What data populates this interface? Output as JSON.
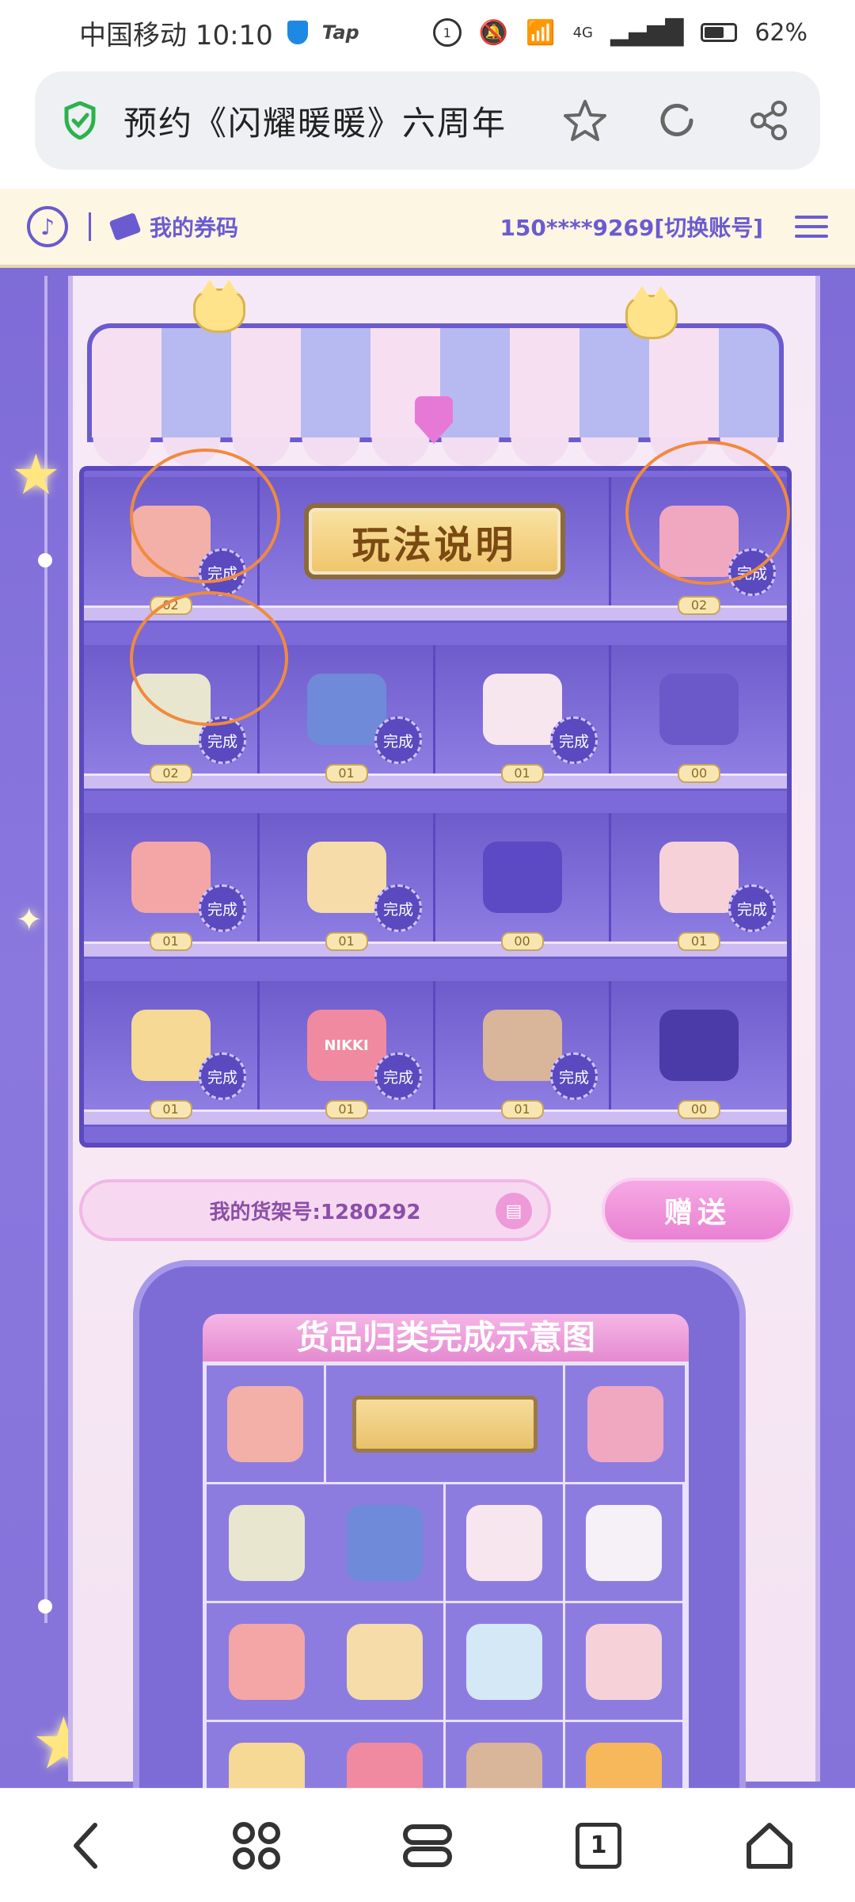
{
  "status_bar": {
    "carrier_time": "中国移动 10:10",
    "tap_label": "Tap",
    "network": "4G",
    "battery": "62%"
  },
  "browser": {
    "title": "预约《闪耀暖暖》六周年",
    "icons": [
      "shield-check-icon",
      "star-icon",
      "refresh-icon",
      "share-icon"
    ]
  },
  "topnav": {
    "coupon_label": "我的券码",
    "account_label": "150****9269[切换账号]"
  },
  "shelf": {
    "play_button": "玩法说明",
    "done_label": "完成",
    "rows": [
      [
        {
          "name": "backpack",
          "count": "02",
          "done": true,
          "color": "#f3b0a8"
        },
        {
          "name": "play-sign",
          "wide": true
        },
        {
          "name": "photo-album",
          "count": "02",
          "done": true,
          "color": "#f0a8c0"
        }
      ],
      [
        {
          "name": "flower-basket",
          "count": "02",
          "done": true,
          "color": "#e9e6cf"
        },
        {
          "name": "perfume",
          "count": "01",
          "done": true,
          "color": "#6f8ad8"
        },
        {
          "name": "shell",
          "count": "01",
          "done": true,
          "color": "#f7e6ee"
        },
        {
          "name": "mug",
          "count": "00",
          "done": false,
          "color": "#6b58c9"
        }
      ],
      [
        {
          "name": "cap",
          "count": "01",
          "done": true,
          "color": "#f4a6a6"
        },
        {
          "name": "suitcase",
          "count": "01",
          "done": true,
          "color": "#f6dca8"
        },
        {
          "name": "crystal-ball",
          "count": "00",
          "done": false,
          "color": "#5c49c4"
        },
        {
          "name": "milk-carton",
          "count": "01",
          "done": true,
          "color": "#f6d2d8"
        }
      ],
      [
        {
          "name": "moon-pillow",
          "count": "01",
          "done": true,
          "color": "#f5d994"
        },
        {
          "name": "eyeshadow-palette",
          "count": "01",
          "done": true,
          "color": "#f08aa0",
          "label": "NIKKI"
        },
        {
          "name": "cake",
          "count": "01",
          "done": true,
          "color": "#d9b59a"
        },
        {
          "name": "camera",
          "count": "00",
          "done": false,
          "color": "#4b3ba8"
        }
      ]
    ],
    "shelf_number": "我的货架号:1280292",
    "gift_button": "赠送"
  },
  "diagram": {
    "title": "货品归类完成示意图",
    "items": [
      {
        "name": "backpack",
        "color": "#f3b0a8"
      },
      {
        "name": "placard",
        "span": 2
      },
      {
        "name": "photo-album",
        "color": "#f0a8c0"
      },
      {
        "name": "flower-basket",
        "color": "#e9e6cf"
      },
      {
        "name": "perfume",
        "color": "#6f8ad8"
      },
      {
        "name": "shell",
        "color": "#f7e6ee"
      },
      {
        "name": "mug",
        "color": "#f6f1f7"
      },
      {
        "name": "cap",
        "color": "#f4a6a6"
      },
      {
        "name": "suitcase",
        "color": "#f6dca8"
      },
      {
        "name": "crystal-ball",
        "color": "#d5e8f6"
      },
      {
        "name": "milk-carton",
        "color": "#f6d2d8"
      },
      {
        "name": "moon-pillow",
        "color": "#f5d994"
      },
      {
        "name": "eyeshadow-palette",
        "color": "#f08aa0"
      },
      {
        "name": "cake",
        "color": "#d9b59a"
      },
      {
        "name": "camera",
        "color": "#f6b85a"
      }
    ]
  },
  "bottom_nav": {
    "tab_count": "1",
    "icons": [
      "back-icon",
      "apps-icon",
      "tabs-icon",
      "tab-count-icon",
      "home-icon"
    ]
  },
  "colors": {
    "accent_purple": "#6b5bd0",
    "annotation_orange": "#f08a3e",
    "gift_pink": "#e981d2"
  }
}
